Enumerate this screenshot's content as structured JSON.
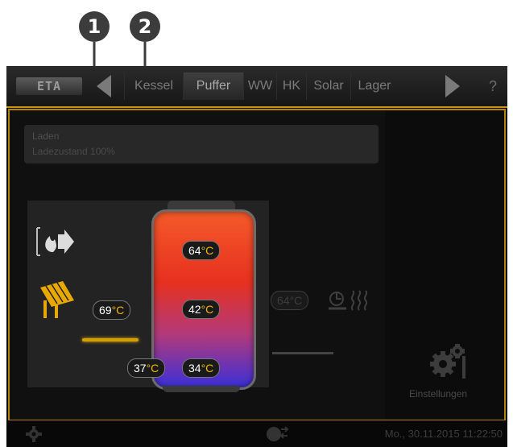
{
  "callouts": [
    "1",
    "2"
  ],
  "topbar": {
    "logo_text": "ETA",
    "tabs": [
      {
        "label": "Kessel",
        "active": false
      },
      {
        "label": "Puffer",
        "active": true
      },
      {
        "label": "WW",
        "active": false
      },
      {
        "label": "HK",
        "active": false
      },
      {
        "label": "Solar",
        "active": false
      },
      {
        "label": "Lager",
        "active": false
      }
    ],
    "help_label": "?"
  },
  "status": {
    "title": "Laden",
    "subtitle": "Ladezustand 100%"
  },
  "temperatures": {
    "solar_flow": "69",
    "tank_top": "64",
    "tank_middle": "42",
    "tank_bottom": "34",
    "solar_return": "37",
    "consumer": "64",
    "unit": "°C"
  },
  "settings_label": "Einstellungen",
  "bottombar": {
    "datetime": "Mo., 30.11.2015 11:22:50"
  },
  "colors": {
    "accent": "#c9950c",
    "unit": "#f2b705",
    "solar": "#e8a800"
  }
}
